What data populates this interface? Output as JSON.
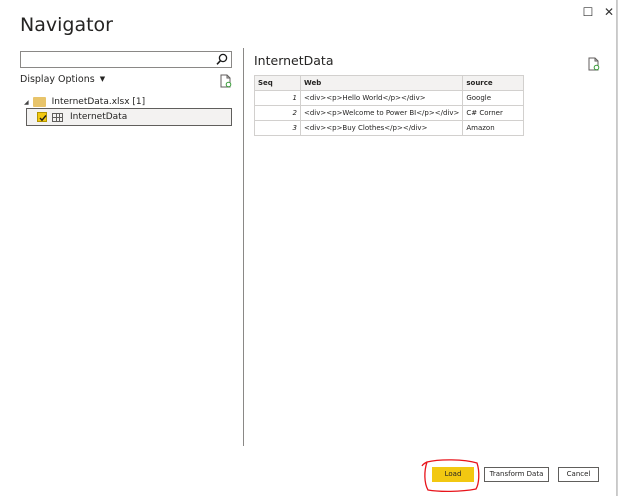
{
  "window": {
    "title": "Navigator",
    "maximize_glyph": "☐",
    "close_glyph": "✕"
  },
  "left_panel": {
    "search": {
      "value": "",
      "placeholder": ""
    },
    "display_options_label": "Display Options",
    "tree": {
      "file": {
        "label": "InternetData.xlsx [1]"
      },
      "sheets": [
        {
          "label": "InternetData",
          "checked": true
        }
      ]
    }
  },
  "preview": {
    "title": "InternetData",
    "columns": [
      "Seq",
      "Web",
      "source"
    ],
    "rows": [
      {
        "seq": "1",
        "web": "<div><p>Hello World</p></div>",
        "source": "Google"
      },
      {
        "seq": "2",
        "web": "<div><p>Welcome to Power BI</p></div>",
        "source": "C# Corner"
      },
      {
        "seq": "3",
        "web": "<div><p>Buy Clothes</p></div>",
        "source": "Amazon"
      }
    ]
  },
  "footer": {
    "load_label": "Load",
    "transform_label": "Transform Data",
    "cancel_label": "Cancel"
  },
  "colors": {
    "accent": "#f2c811",
    "annotation": "#e8141b",
    "folder": "#e8c46b"
  },
  "icons": {
    "search": "search-icon",
    "refresh": "refresh-page-icon",
    "folder": "folder-icon",
    "table": "table-icon",
    "checkbox": "checkbox-checked-icon"
  }
}
